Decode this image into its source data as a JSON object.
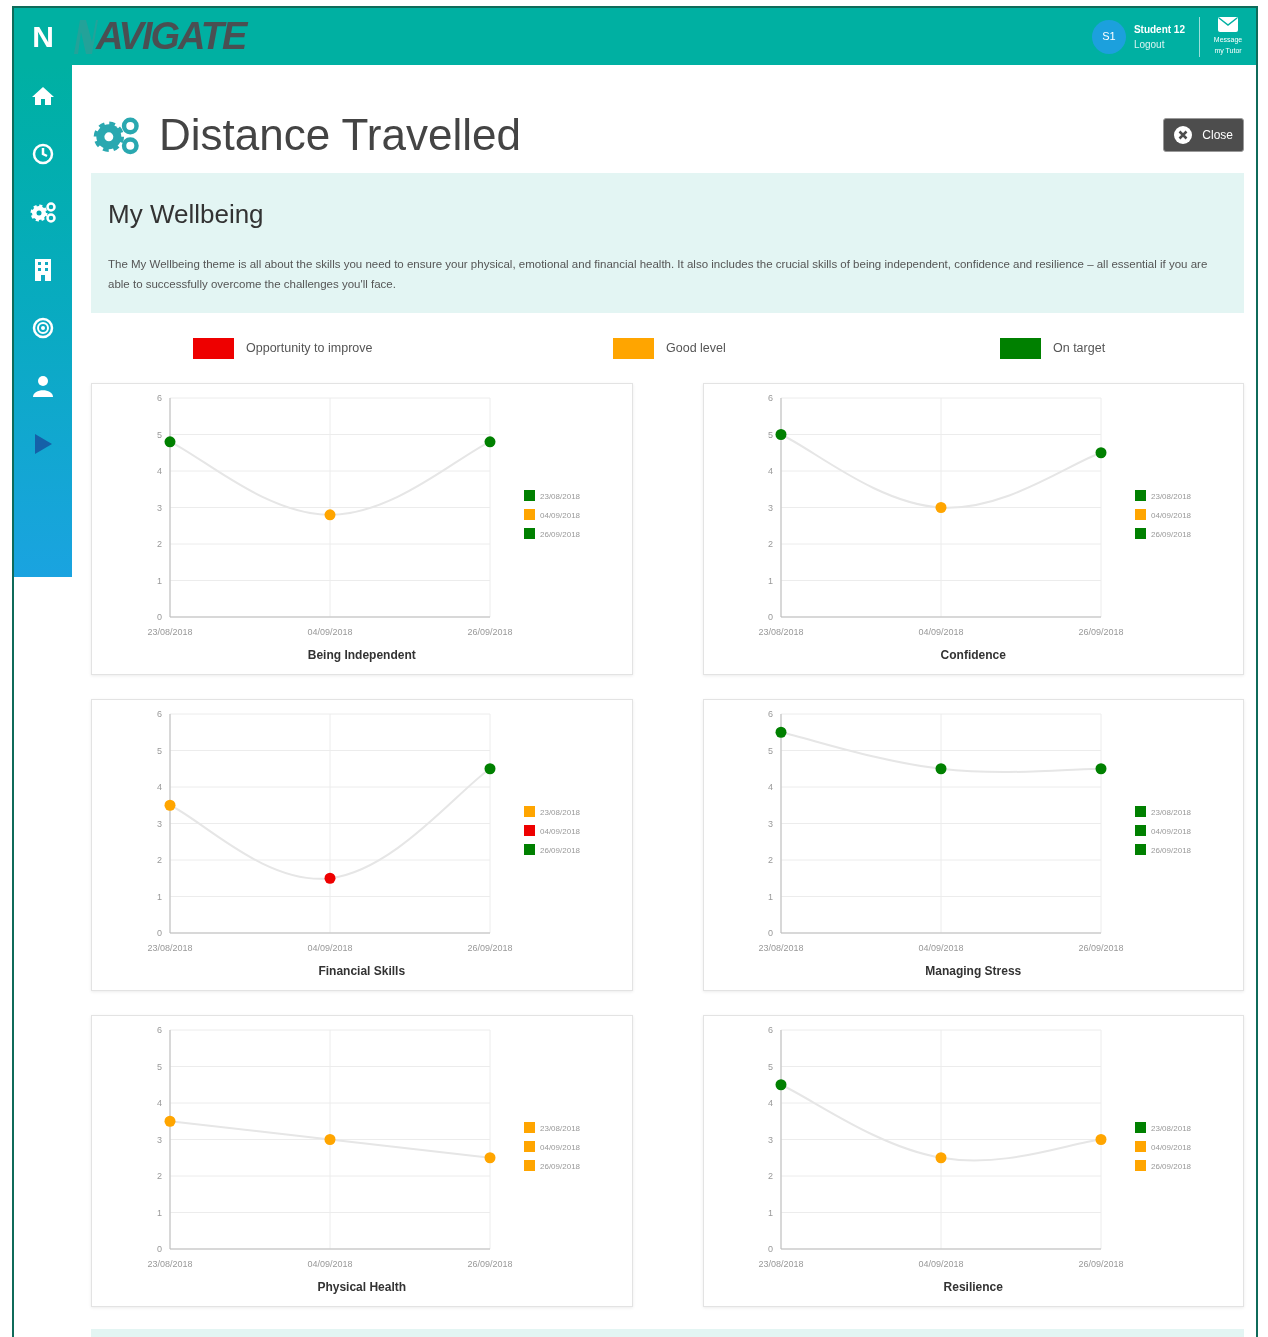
{
  "header": {
    "logo_mark": "N",
    "brand": "AVIGATE",
    "avatar": "S1",
    "user_name": "Student 12",
    "logout": "Logout",
    "message_line1": "Message",
    "message_line2": "my Tutor"
  },
  "page": {
    "title": "Distance Travelled",
    "close": "Close"
  },
  "theme": {
    "title": "My Wellbeing",
    "description": "The My Wellbeing theme is all about the skills you need to ensure your physical, emotional and financial health. It also includes the crucial skills of being independent, confidence and resilience – all essential if you are able to successfully overcome the challenges you'll face."
  },
  "key": [
    {
      "label": "Opportunity to improve",
      "color": "#ee0000"
    },
    {
      "label": "Good level",
      "color": "#ffa500"
    },
    {
      "label": "On target",
      "color": "#008000"
    }
  ],
  "charts": [
    {
      "legend": [
        {
          "label": "23/08/2018",
          "color": "#008000"
        },
        {
          "label": "04/09/2018",
          "color": "#ffa500"
        },
        {
          "label": "26/09/2018",
          "color": "#008000"
        }
      ],
      "chart_data": {
        "type": "line",
        "title": "Being Independent",
        "grid": true,
        "categories": [
          "23/08/2018",
          "04/09/2018",
          "26/09/2018"
        ],
        "series": [
          {
            "color": "#e6e6e6",
            "marker": true,
            "values": [
              4.8,
              2.8,
              4.8
            ]
          }
        ],
        "ylim": [
          0,
          6
        ],
        "yticks": [
          0,
          1,
          2,
          3,
          4,
          5,
          6
        ]
      }
    },
    {
      "legend": [
        {
          "label": "23/08/2018",
          "color": "#008000"
        },
        {
          "label": "04/09/2018",
          "color": "#ffa500"
        },
        {
          "label": "26/09/2018",
          "color": "#008000"
        }
      ],
      "chart_data": {
        "type": "line",
        "title": "Confidence",
        "grid": true,
        "categories": [
          "23/08/2018",
          "04/09/2018",
          "26/09/2018"
        ],
        "series": [
          {
            "color": "#e6e6e6",
            "marker": true,
            "values": [
              5,
              3,
              4.5
            ]
          }
        ],
        "ylim": [
          0,
          6
        ],
        "yticks": [
          0,
          1,
          2,
          3,
          4,
          5,
          6
        ]
      }
    },
    {
      "legend": [
        {
          "label": "23/08/2018",
          "color": "#ffa500"
        },
        {
          "label": "04/09/2018",
          "color": "#ee0000"
        },
        {
          "label": "26/09/2018",
          "color": "#008000"
        }
      ],
      "chart_data": {
        "type": "line",
        "title": "Financial Skills",
        "grid": true,
        "categories": [
          "23/08/2018",
          "04/09/2018",
          "26/09/2018"
        ],
        "series": [
          {
            "color": "#e6e6e6",
            "marker": true,
            "values": [
              3.5,
              1.5,
              4.5
            ]
          }
        ],
        "ylim": [
          0,
          6
        ],
        "yticks": [
          0,
          1,
          2,
          3,
          4,
          5,
          6
        ]
      }
    },
    {
      "legend": [
        {
          "label": "23/08/2018",
          "color": "#008000"
        },
        {
          "label": "04/09/2018",
          "color": "#008000"
        },
        {
          "label": "26/09/2018",
          "color": "#008000"
        }
      ],
      "chart_data": {
        "type": "line",
        "title": "Managing Stress",
        "grid": true,
        "categories": [
          "23/08/2018",
          "04/09/2018",
          "26/09/2018"
        ],
        "series": [
          {
            "color": "#e6e6e6",
            "marker": true,
            "values": [
              5.5,
              4.5,
              4.5
            ]
          }
        ],
        "ylim": [
          0,
          6
        ],
        "yticks": [
          0,
          1,
          2,
          3,
          4,
          5,
          6
        ]
      }
    },
    {
      "legend": [
        {
          "label": "23/08/2018",
          "color": "#ffa500"
        },
        {
          "label": "04/09/2018",
          "color": "#ffa500"
        },
        {
          "label": "26/09/2018",
          "color": "#ffa500"
        }
      ],
      "chart_data": {
        "type": "line",
        "title": "Physical Health",
        "grid": true,
        "categories": [
          "23/08/2018",
          "04/09/2018",
          "26/09/2018"
        ],
        "series": [
          {
            "color": "#e6e6e6",
            "marker": true,
            "values": [
              3.5,
              3,
              2.5
            ]
          }
        ],
        "ylim": [
          0,
          6
        ],
        "yticks": [
          0,
          1,
          2,
          3,
          4,
          5,
          6
        ]
      }
    },
    {
      "legend": [
        {
          "label": "23/08/2018",
          "color": "#008000"
        },
        {
          "label": "04/09/2018",
          "color": "#ffa500"
        },
        {
          "label": "26/09/2018",
          "color": "#ffa500"
        }
      ],
      "chart_data": {
        "type": "line",
        "title": "Resilience",
        "grid": true,
        "categories": [
          "23/08/2018",
          "04/09/2018",
          "26/09/2018"
        ],
        "series": [
          {
            "color": "#e6e6e6",
            "marker": true,
            "values": [
              4.5,
              2.5,
              3
            ]
          }
        ],
        "ylim": [
          0,
          6
        ],
        "yticks": [
          0,
          1,
          2,
          3,
          4,
          5,
          6
        ]
      }
    }
  ]
}
